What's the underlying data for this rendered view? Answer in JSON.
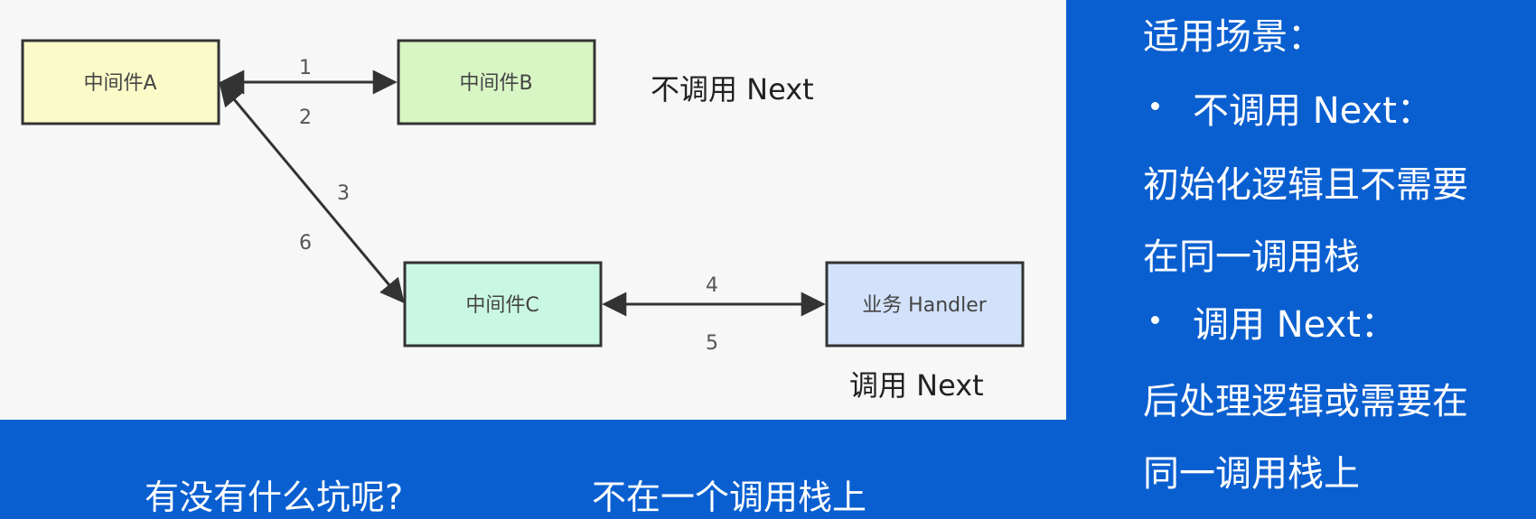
{
  "diagram": {
    "nodes": {
      "a": {
        "label": "中间件A",
        "fill": "#fbfbc9"
      },
      "b": {
        "label": "中间件B",
        "fill": "#d8f5c4"
      },
      "c": {
        "label": "中间件C",
        "fill": "#c9f7e4"
      },
      "handler": {
        "label": "业务 Handler",
        "fill": "#d2e2fb"
      }
    },
    "edges": {
      "ab": {
        "label_forward": "1",
        "label_back": "2"
      },
      "ac": {
        "label_forward": "3",
        "label_back": "6"
      },
      "ch": {
        "label_forward": "4",
        "label_back": "5"
      }
    },
    "captions": {
      "no_next": "不调用  Next",
      "call_next": "调用  Next"
    }
  },
  "sidebar": {
    "title": "适用场景：",
    "items": [
      {
        "heading": "不调用  Next：",
        "lines": [
          "初始化逻辑且不需要",
          "在同一调用栈"
        ]
      },
      {
        "heading": "调用  Next：",
        "lines": [
          "后处理逻辑或需要在",
          "同一调用栈上"
        ]
      }
    ]
  },
  "bottom": {
    "question": "有没有什么坑呢?",
    "answer": "不在一个调用栈上"
  },
  "colors": {
    "background_blue": "#0a5fd0",
    "panel_gray": "#f7f7f7",
    "arrow": "#333333"
  }
}
